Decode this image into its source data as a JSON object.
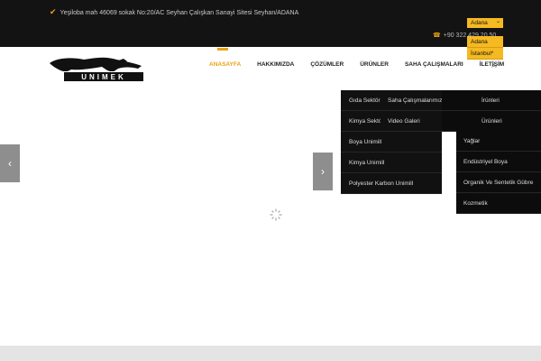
{
  "topbar": {
    "address": "Yeşiloba mah 46069 sokak No:20/AC Seyhan Çalışkan Sanayi Sitesi Seyhan/ADANA",
    "phone": "+90 322 429 20 50",
    "city_selected": "Adana",
    "city_options": [
      "Adana",
      "İstanbul*"
    ]
  },
  "logo": {
    "text": "UNIMEK"
  },
  "nav": {
    "items": [
      "ANASAYFA",
      "HAKKIMIZDA",
      "ÇÖZÜMLER",
      "ÜRÜNLER",
      "SAHA ÇALIŞMALARI",
      "İLETİŞİM"
    ]
  },
  "dropdowns": {
    "cozumler": [
      "Gıda Sektörü",
      "Kimya Sektörü",
      "Boya Unimill",
      "Kimya Unimill",
      "Polyester Karbon Unimill"
    ],
    "saha": [
      "Saha Çalışmalarımız",
      "Video Galeri"
    ],
    "urunler": [
      "İrünleri",
      "Ürünleri"
    ],
    "urunler_sub": [
      "Yağlar",
      "Endüstriyel Boya",
      "Organik Ve Sentetik Gübre",
      "Kozmetik"
    ]
  },
  "colors": {
    "accent": "#e8a317",
    "topbar": "#131313",
    "dropdown": "#111111"
  }
}
